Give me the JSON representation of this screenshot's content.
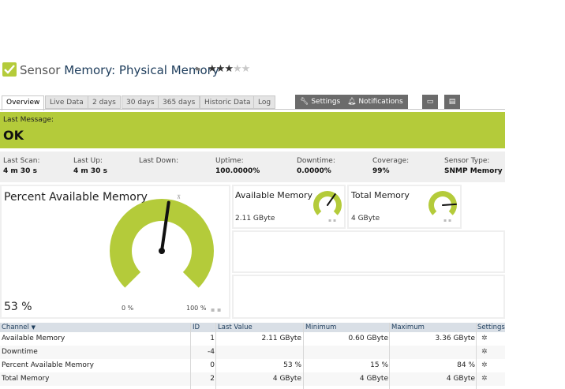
{
  "header": {
    "prefix": "Sensor",
    "name": "Memory: Physical Memory",
    "flag_icon": "flag-icon",
    "rating": 3,
    "rating_max": 5
  },
  "tabs": [
    {
      "label": "Overview",
      "active": true
    },
    {
      "label": "Live Data"
    },
    {
      "label": "2 days"
    },
    {
      "label": "30 days"
    },
    {
      "label": "365 days"
    },
    {
      "label": "Historic Data"
    },
    {
      "label": "Log"
    }
  ],
  "actions": {
    "settings_label": "Settings",
    "notifications_label": "Notifications"
  },
  "message": {
    "label": "Last Message:",
    "value": "OK",
    "color": "#b4cb3a"
  },
  "stats": [
    {
      "label": "Last Scan:",
      "value": "4 m 30 s"
    },
    {
      "label": "Last Up:",
      "value": "4 m 30 s"
    },
    {
      "label": "Last Down:",
      "value": ""
    },
    {
      "label": "Uptime:",
      "value": "100.0000%"
    },
    {
      "label": "Downtime:",
      "value": "0.0000%"
    },
    {
      "label": "Coverage:",
      "value": "99%"
    },
    {
      "label": "Sensor Type:",
      "value": "SNMP Memory"
    }
  ],
  "main_gauge": {
    "title": "Percent Available Memory",
    "value": "53 %",
    "min_label": "0 %",
    "max_label": "100 %",
    "percent": 53
  },
  "gauge_available": {
    "title": "Available Memory",
    "value": "2.11 GByte",
    "fraction": 0.63
  },
  "gauge_total": {
    "title": "Total Memory",
    "value": "4 GByte",
    "fraction": 0.82
  },
  "table": {
    "headers": {
      "channel": "Channel",
      "id": "ID",
      "last_value": "Last Value",
      "minimum": "Minimum",
      "maximum": "Maximum",
      "settings": "Settings"
    },
    "rows": [
      {
        "channel": "Available Memory",
        "id": "1",
        "last_value": "2.11 GByte",
        "minimum": "0.60 GByte",
        "maximum": "3.36 GByte"
      },
      {
        "channel": "Downtime",
        "id": "-4",
        "last_value": "",
        "minimum": "",
        "maximum": ""
      },
      {
        "channel": "Percent Available Memory",
        "id": "0",
        "last_value": "53 %",
        "minimum": "15 %",
        "maximum": "84 %"
      },
      {
        "channel": "Total Memory",
        "id": "2",
        "last_value": "4 GByte",
        "minimum": "4 GByte",
        "maximum": "4 GByte"
      }
    ]
  },
  "colors": {
    "accent": "#b4cb3a",
    "header_blue": "#1e3d5c",
    "button_gray": "#6b6b6b"
  }
}
